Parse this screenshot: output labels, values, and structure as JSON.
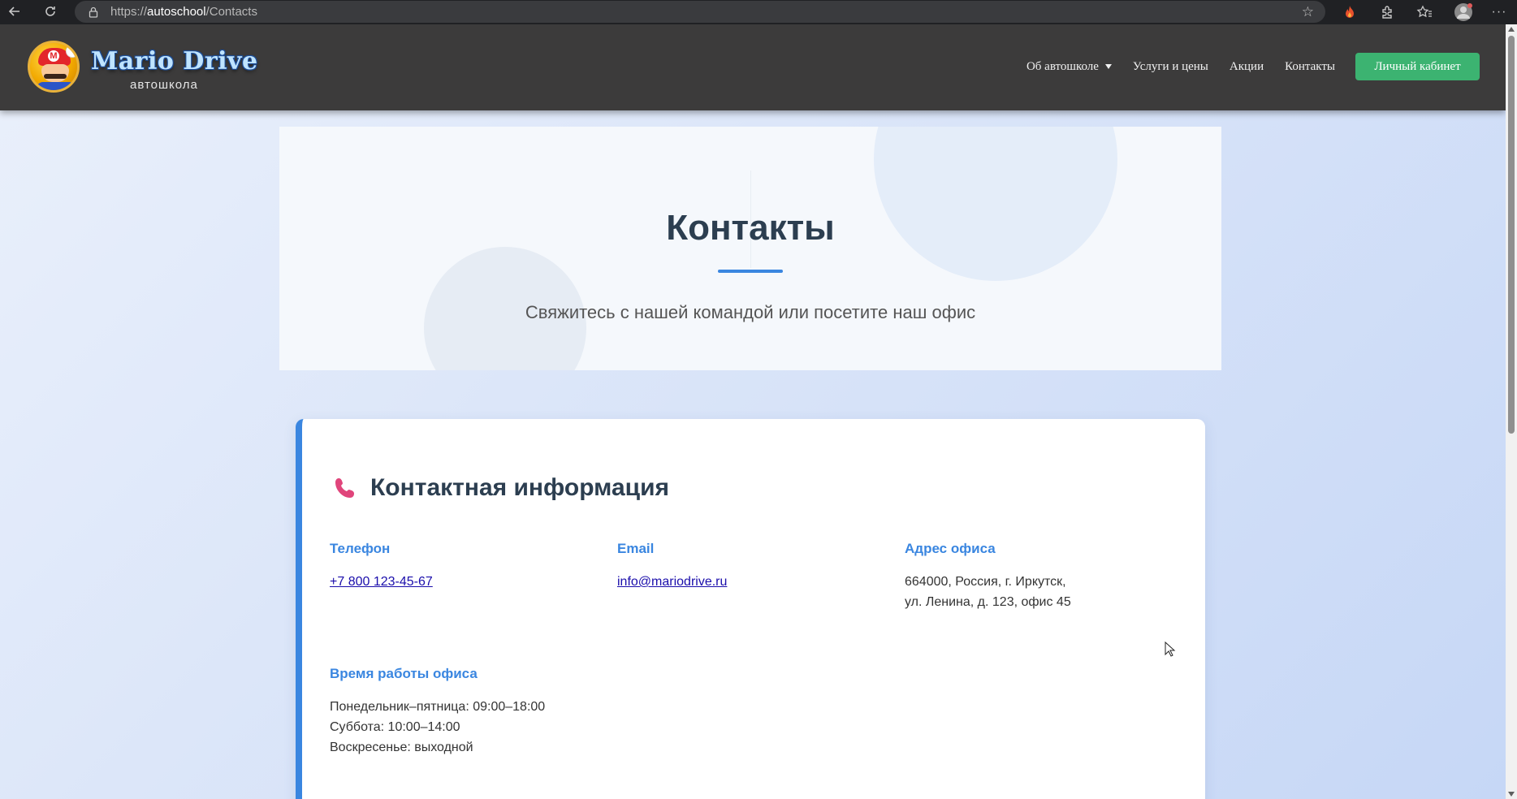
{
  "browser": {
    "url_prefix": "https://",
    "url_host": "autoschool",
    "url_path": "/Contacts"
  },
  "header": {
    "brand_name": "Mario Drive",
    "brand_sub": "автошкола",
    "nav": {
      "about": "Об автошколе",
      "services": "Услуги и цены",
      "promotions": "Акции",
      "contacts": "Контакты",
      "account_button": "Личный кабинет"
    }
  },
  "hero": {
    "title": "Контакты",
    "subtitle": "Свяжитесь с нашей командой или посетите наш офис"
  },
  "card": {
    "title": "Контактная информация",
    "phone": {
      "heading": "Телефон",
      "value": "+7 800 123-45-67"
    },
    "email": {
      "heading": "Email",
      "value": "info@mariodrive.ru"
    },
    "address": {
      "heading": "Адрес офиса",
      "line1": "664000, Россия, г. Иркутск,",
      "line2": "ул. Ленина, д. 123, офис 45"
    },
    "hours": {
      "heading": "Время работы офиса",
      "weekdays": "Понедельник–пятница: 09:00–18:00",
      "saturday": "Суббота: 10:00–14:00",
      "sunday": "Воскресенье: выходной"
    }
  },
  "colors": {
    "accent": "#3a86e0",
    "header_bg": "#3c3b3b",
    "button_green": "#3cb371",
    "phone_icon": "#e0457b"
  }
}
